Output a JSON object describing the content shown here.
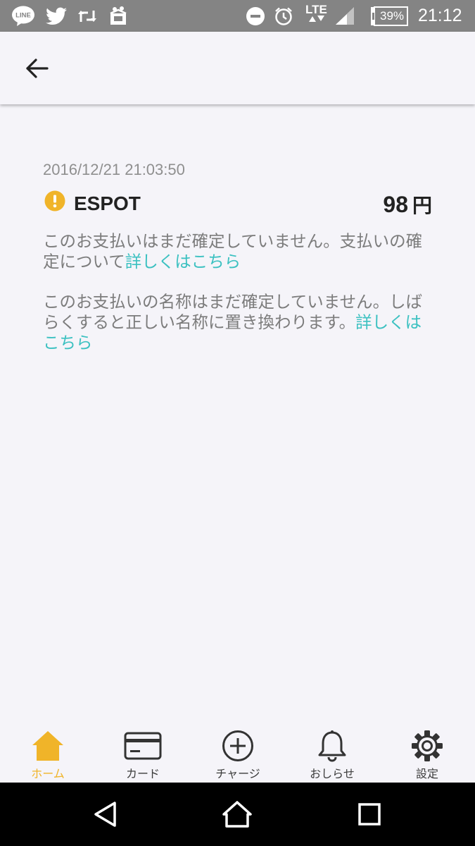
{
  "status_bar": {
    "apps": [
      "line-icon",
      "twitter-icon",
      "retweet-icon",
      "box-icon"
    ],
    "line_text": "LINE",
    "network": "LTE",
    "battery_percent": "39%",
    "time": "21:12"
  },
  "transaction": {
    "date": "2016/12/21 21:03:50",
    "status_icon": "warning-icon",
    "merchant": "ESPOT",
    "amount": "98",
    "currency": "円"
  },
  "notices": [
    {
      "text": "このお支払いはまだ確定していません。支払いの確定について",
      "link": "詳しくはこちら"
    },
    {
      "text": "このお支払いの名称はまだ確定していません。しばらくすると正しい名称に置き換わります。",
      "link": "詳しくはこちら"
    }
  ],
  "bottom_nav": {
    "items": [
      {
        "label": "ホーム",
        "icon": "home-icon",
        "active": true
      },
      {
        "label": "カード",
        "icon": "card-icon",
        "active": false
      },
      {
        "label": "チャージ",
        "icon": "plus-circle-icon",
        "active": false
      },
      {
        "label": "おしらせ",
        "icon": "bell-icon",
        "active": false
      },
      {
        "label": "設定",
        "icon": "gear-icon",
        "active": false
      }
    ]
  },
  "colors": {
    "accent_link": "#3cc1c1",
    "active_tab": "#f0b429",
    "warning": "#f0b429",
    "status_bar": "#848484",
    "background": "#f5f4f9"
  }
}
